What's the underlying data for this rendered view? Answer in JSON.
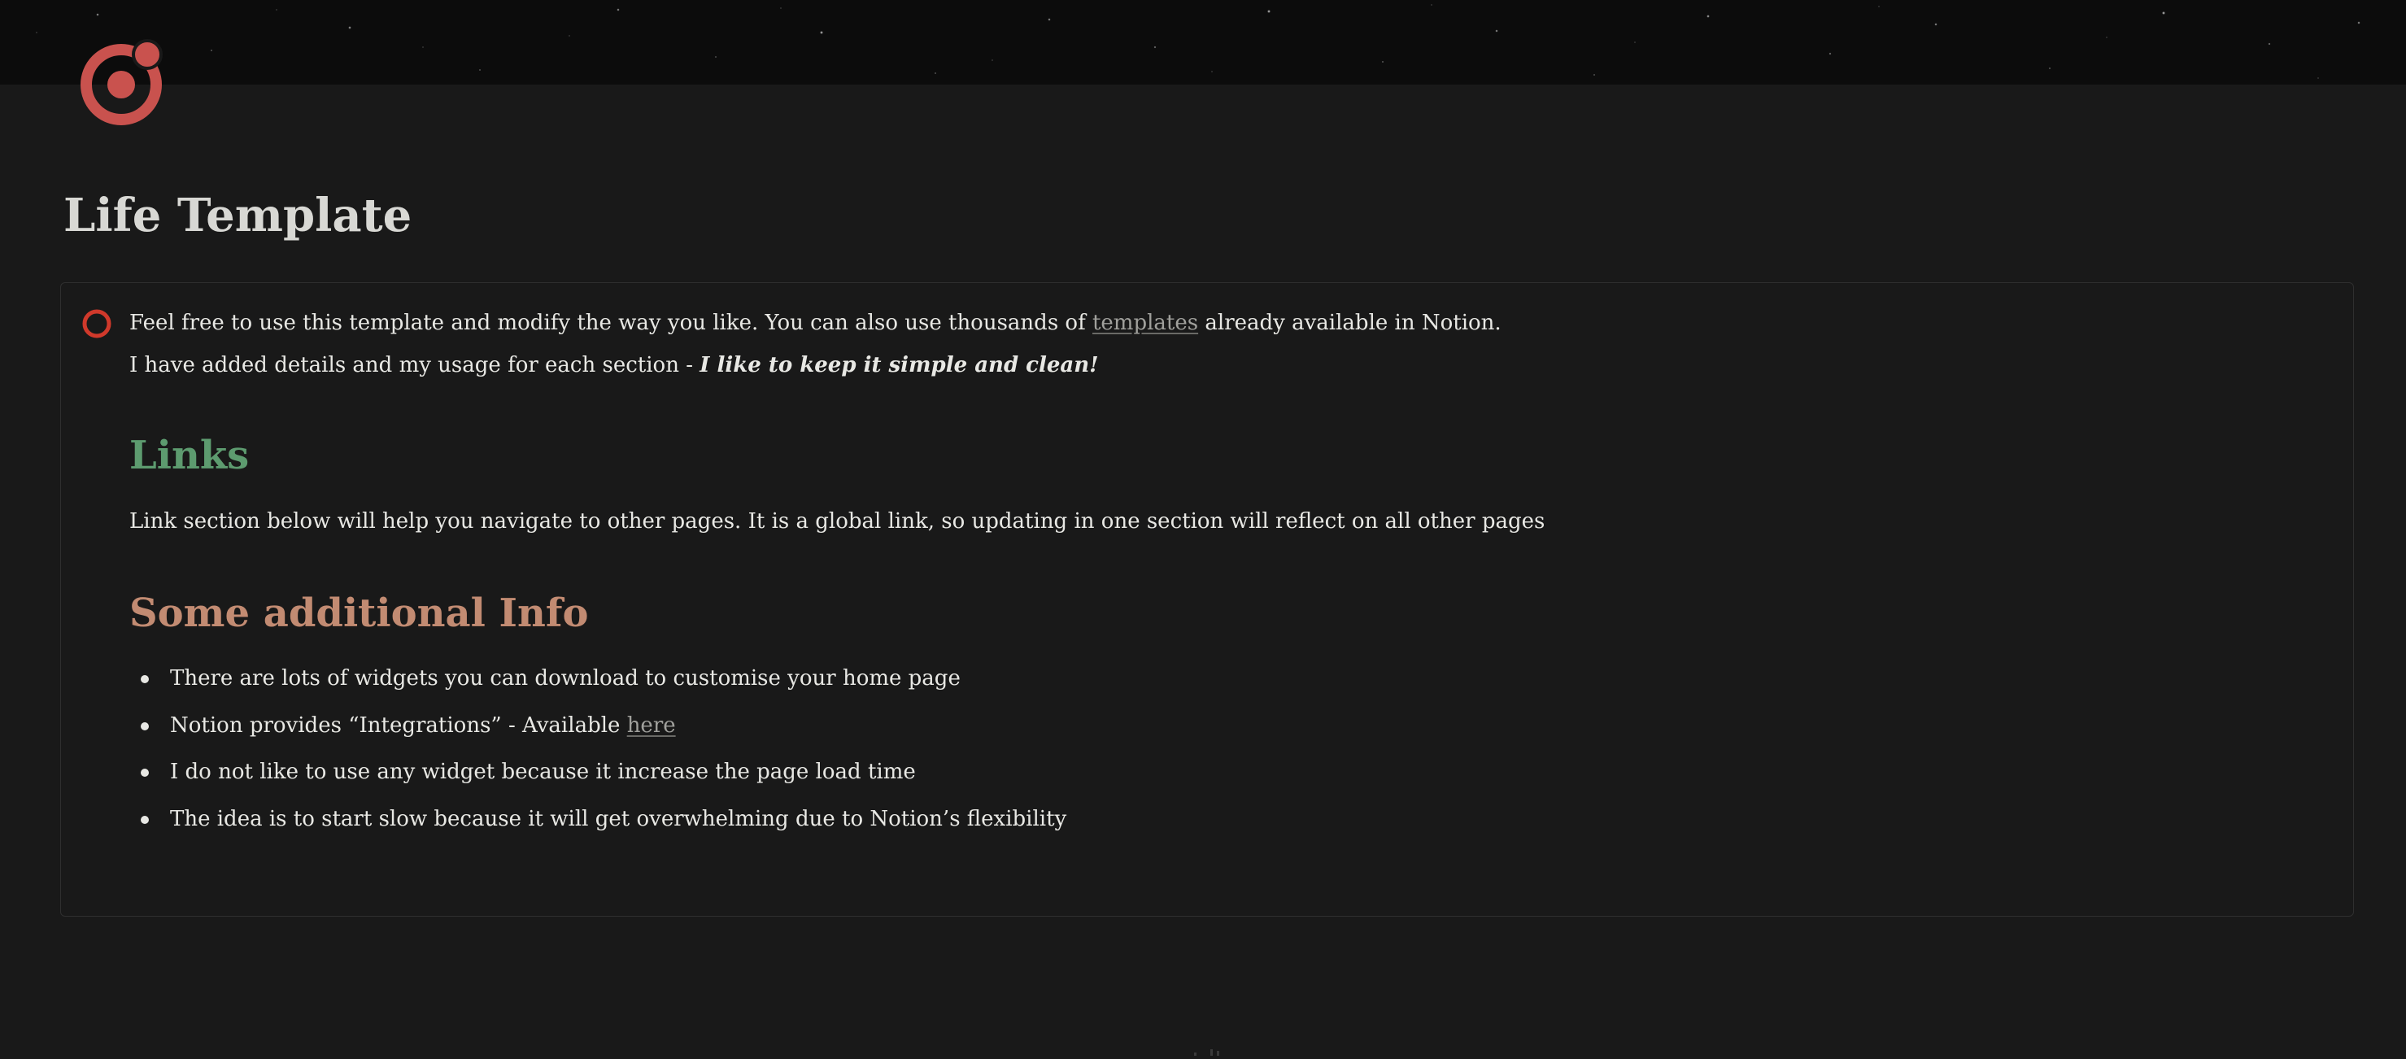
{
  "cover": {
    "description_color": "#0c0c0c"
  },
  "page": {
    "icon": "target-icon",
    "icon_color": "#c9524e",
    "title": "Life Template"
  },
  "callout": {
    "icon": "circle-outline-icon",
    "icon_color": "#d0392b",
    "line1": {
      "before": "Feel free to use this template and modify the way you  like. You can also use thousands of ",
      "link": "templates",
      "after": " already available in Notion."
    },
    "line2": {
      "before": "I have added details and my usage  for each section -  ",
      "emphasis": "I  like to keep it simple and clean!"
    },
    "links_heading": "Links",
    "links_heading_color": "#5d9b6f",
    "links_description": "Link section below will help you navigate to other pages. It is a global link, so updating in one section will reflect on all other pages",
    "info_heading": "Some additional Info",
    "info_heading_color": "#c28b72",
    "bullets": [
      {
        "text": "There are lots of widgets you can download to customise your home page"
      },
      {
        "text": "Notion provides “Integrations” - Available ",
        "link": "here"
      },
      {
        "text": "I do not like to use any widget because it increase the page load time"
      },
      {
        "text": "The idea is to start slow because it will get overwhelming due to Notion’s flexibility"
      }
    ]
  }
}
